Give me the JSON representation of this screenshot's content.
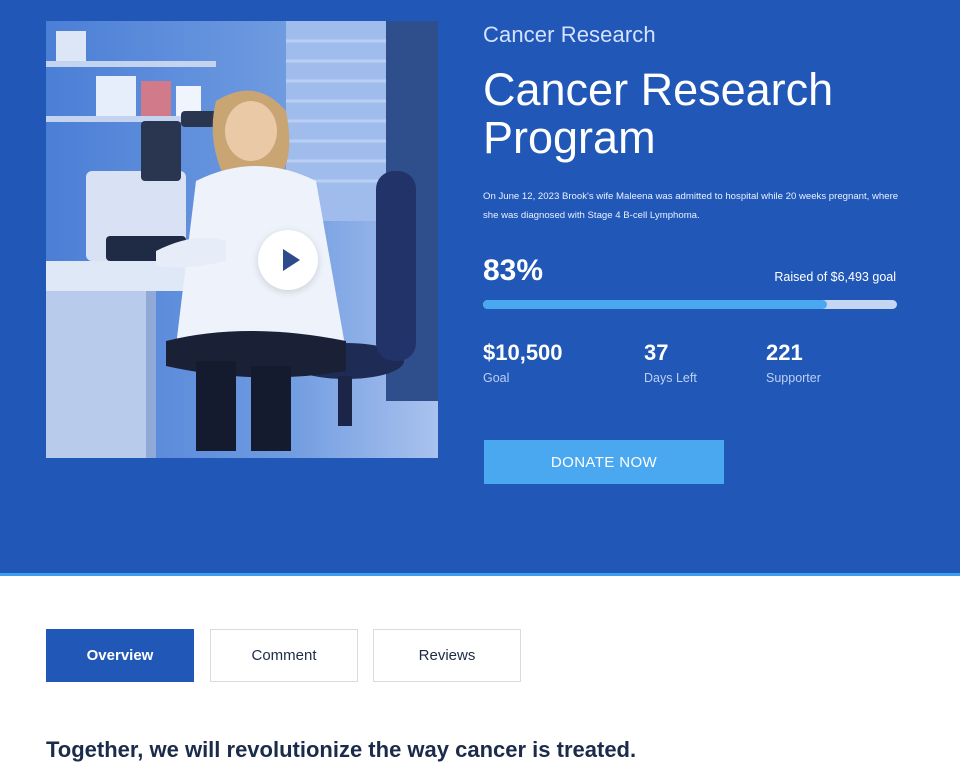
{
  "hero": {
    "category": "Cancer Research",
    "title": "Cancer Research Program",
    "description": "On June 12, 2023 Brook's wife Maleena was admitted to hospital while 20 weeks pregnant, where she was diagnosed with Stage 4 B-cell Lymphoma.",
    "video": {
      "icon": "play-icon"
    },
    "progress": {
      "percent_label": "83%",
      "percent_value": 0.83,
      "raised_label": "Raised of $6,493 goal"
    },
    "stats": [
      {
        "value": "$10,500",
        "label": "Goal"
      },
      {
        "value": "37",
        "label": "Days Left"
      },
      {
        "value": "221",
        "label": "Supporter"
      }
    ],
    "donate_label": "DONATE NOW"
  },
  "tabs": [
    {
      "label": "Overview",
      "active": true
    },
    {
      "label": "Comment",
      "active": false
    },
    {
      "label": "Reviews",
      "active": false
    }
  ],
  "content": {
    "headline": "Together, we will revolutionize the way cancer is treated."
  },
  "colors": {
    "hero_bg": "#2158b8",
    "accent": "#4aa8f0",
    "progress_track": "#c5d6f3",
    "text_dark": "#1b2c4a"
  }
}
